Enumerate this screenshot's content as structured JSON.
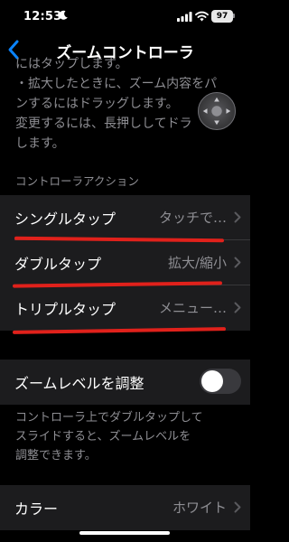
{
  "status_bar": {
    "time": "12:53",
    "battery": "97",
    "moon_icon": "moon-icon",
    "signal_icon": "cellular-signal-icon",
    "wifi_icon": "wifi-icon"
  },
  "nav": {
    "back_icon": "chevron-left-icon",
    "title": "ズームコントローラ"
  },
  "description": {
    "lines": [
      "にはタップします。",
      "・拡大したときに、ズーム内容をパ",
      "ンするにはドラッグします。",
      "変更するには、長押ししてドラ",
      "します。"
    ]
  },
  "section_header": "コントローラアクション",
  "actions": [
    {
      "label": "シングルタップ",
      "value": "タッチで…"
    },
    {
      "label": "ダブルタップ",
      "value": "拡大/縮小"
    },
    {
      "label": "トリプルタップ",
      "value": "メニュー…"
    }
  ],
  "zoom_level": {
    "label": "ズームレベルを調整",
    "toggle_on": false
  },
  "footer": {
    "lines": [
      "コントローラ上でダブルタップして",
      "スライドすると、ズームレベルを",
      "調整できます。"
    ]
  },
  "color_row": {
    "label": "カラー",
    "value": "ホワイト"
  },
  "colors": {
    "background": "#000000",
    "group_background": "#1c1c1e",
    "secondary_text": "#8e8e93",
    "accent": "#0a84ff",
    "annotation_red": "#e0211b"
  }
}
